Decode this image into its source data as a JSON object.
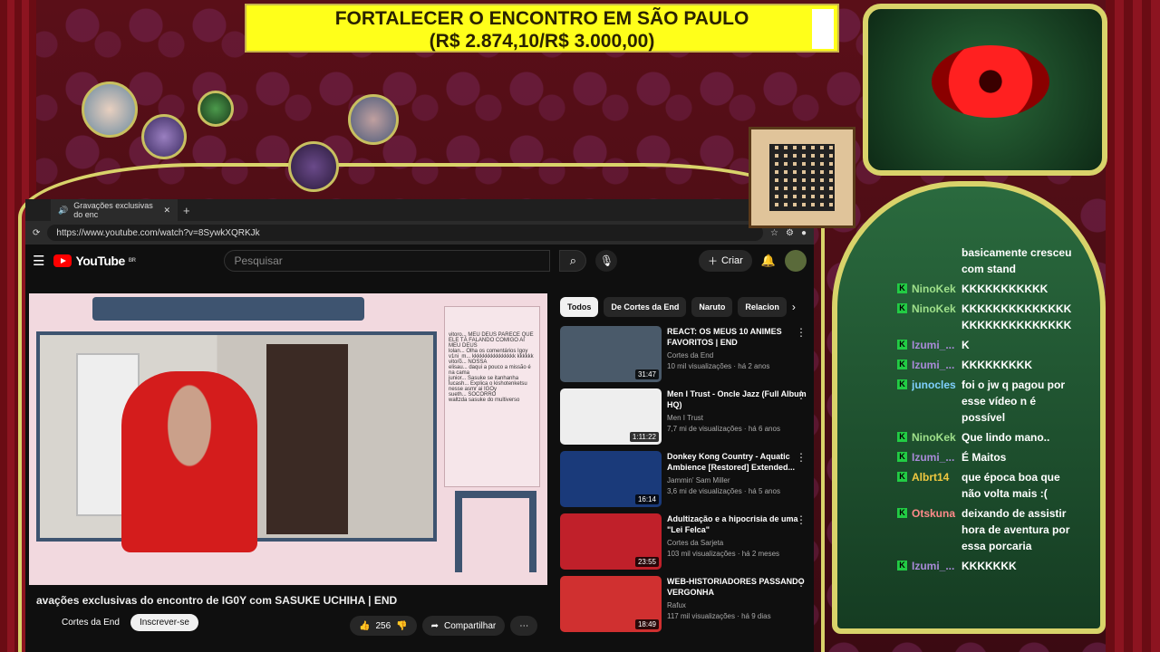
{
  "goal": {
    "line1": "FORTALECER O ENCONTRO EM SÃO PAULO",
    "line2": "(R$ 2.874,10/R$ 3.000,00)",
    "progress": 0.958
  },
  "browser": {
    "tab_title": "Gravações exclusivas do enc",
    "url": "https://www.youtube.com/watch?v=8SywkXQRKJk"
  },
  "youtube": {
    "logo": "YouTube",
    "region": "BR",
    "search_placeholder": "Pesquisar",
    "create_label": "Criar",
    "video": {
      "title": "avações exclusivas do encontro de IG0Y com SASUKE UCHIHA | END",
      "channel": "Cortes da End",
      "subscribe": "Inscrever-se",
      "likes": "256",
      "share": "Compartilhar"
    },
    "stream_chat": [
      "vitoro... MEU DEUS PARECE QUE ELE TÁ FALANDO COMIGO AI MEU DEUS",
      "lolan... Olha os comentários Igoy",
      "v1ni_m... kkkkkkkkkkkkkkkk kkkkkk",
      "vitoro... NOSSA",
      "elisau... daqui a pouco a missão é na cama",
      "junior... Sasuke se itanhanha",
      "lucash... Explica o kishotenketsu nesse asmr ai IGOy",
      "sueth... SOCORRO",
      "waltzda sasuke do multiverso"
    ],
    "chips": [
      "Todos",
      "De Cortes da End",
      "Naruto",
      "Relacion"
    ],
    "recommendations": [
      {
        "title": "REACT: OS MEUS 10 ANIMES FAVORITOS | END",
        "channel": "Cortes da End",
        "meta": "10 mil visualizações · há 2 anos",
        "duration": "31:47",
        "thumb_color": "#4a5a6a"
      },
      {
        "title": "Men I Trust - Oncle Jazz (Full Album HQ)",
        "channel": "Men I Trust",
        "meta": "7,7 mi de visualizações · há 6 anos",
        "duration": "1:11:22",
        "thumb_color": "#eeeeee"
      },
      {
        "title": "Donkey Kong Country - Aquatic Ambience [Restored] Extended...",
        "channel": "Jammin' Sam Miller",
        "meta": "3,6 mi de visualizações · há 5 anos",
        "duration": "16:14",
        "thumb_color": "#1a3a7a"
      },
      {
        "title": "Adultização e a hipocrisia de uma \"Lei Felca\"",
        "channel": "Cortes da Sarjeta",
        "meta": "103 mil visualizações · há 2 meses",
        "duration": "23:55",
        "thumb_color": "#c0202a"
      },
      {
        "title": "WEB-HISTORIADORES PASSANDO VERGONHA",
        "channel": "Rafux",
        "meta": "117 mil visualizações · há 9 dias",
        "duration": "18:49",
        "thumb_color": "#d03030"
      }
    ]
  },
  "twitch_chat": [
    {
      "nick": "",
      "color": "#ffffff",
      "text": "basicamente cresceu com stand"
    },
    {
      "nick": "NinoKek",
      "color": "#9fe08a",
      "text": "KKKKKKKKKKK"
    },
    {
      "nick": "NinoKek",
      "color": "#9fe08a",
      "text": "KKKKKKKKKKKKKK KKKKKKKKKKKKKK"
    },
    {
      "nick": "Izumi_...",
      "color": "#a98ad8",
      "text": "K"
    },
    {
      "nick": "Izumi_...",
      "color": "#a98ad8",
      "text": "KKKKKKKKK"
    },
    {
      "nick": "junocles",
      "color": "#7fd0ff",
      "text": "foi o jw q pagou por esse vídeo n é possível"
    },
    {
      "nick": "NinoKek",
      "color": "#9fe08a",
      "text": "Que lindo mano.."
    },
    {
      "nick": "Izumi_...",
      "color": "#a98ad8",
      "text": "É Maitos"
    },
    {
      "nick": "Albrt14",
      "color": "#f0c840",
      "text": "que época boa que não volta mais :("
    },
    {
      "nick": "Otskuna",
      "color": "#ff8a8a",
      "text": "deixando de assistir hora de aventura por essa porcaria"
    },
    {
      "nick": "Izumi_...",
      "color": "#a98ad8",
      "text": "KKKKKKK"
    }
  ]
}
